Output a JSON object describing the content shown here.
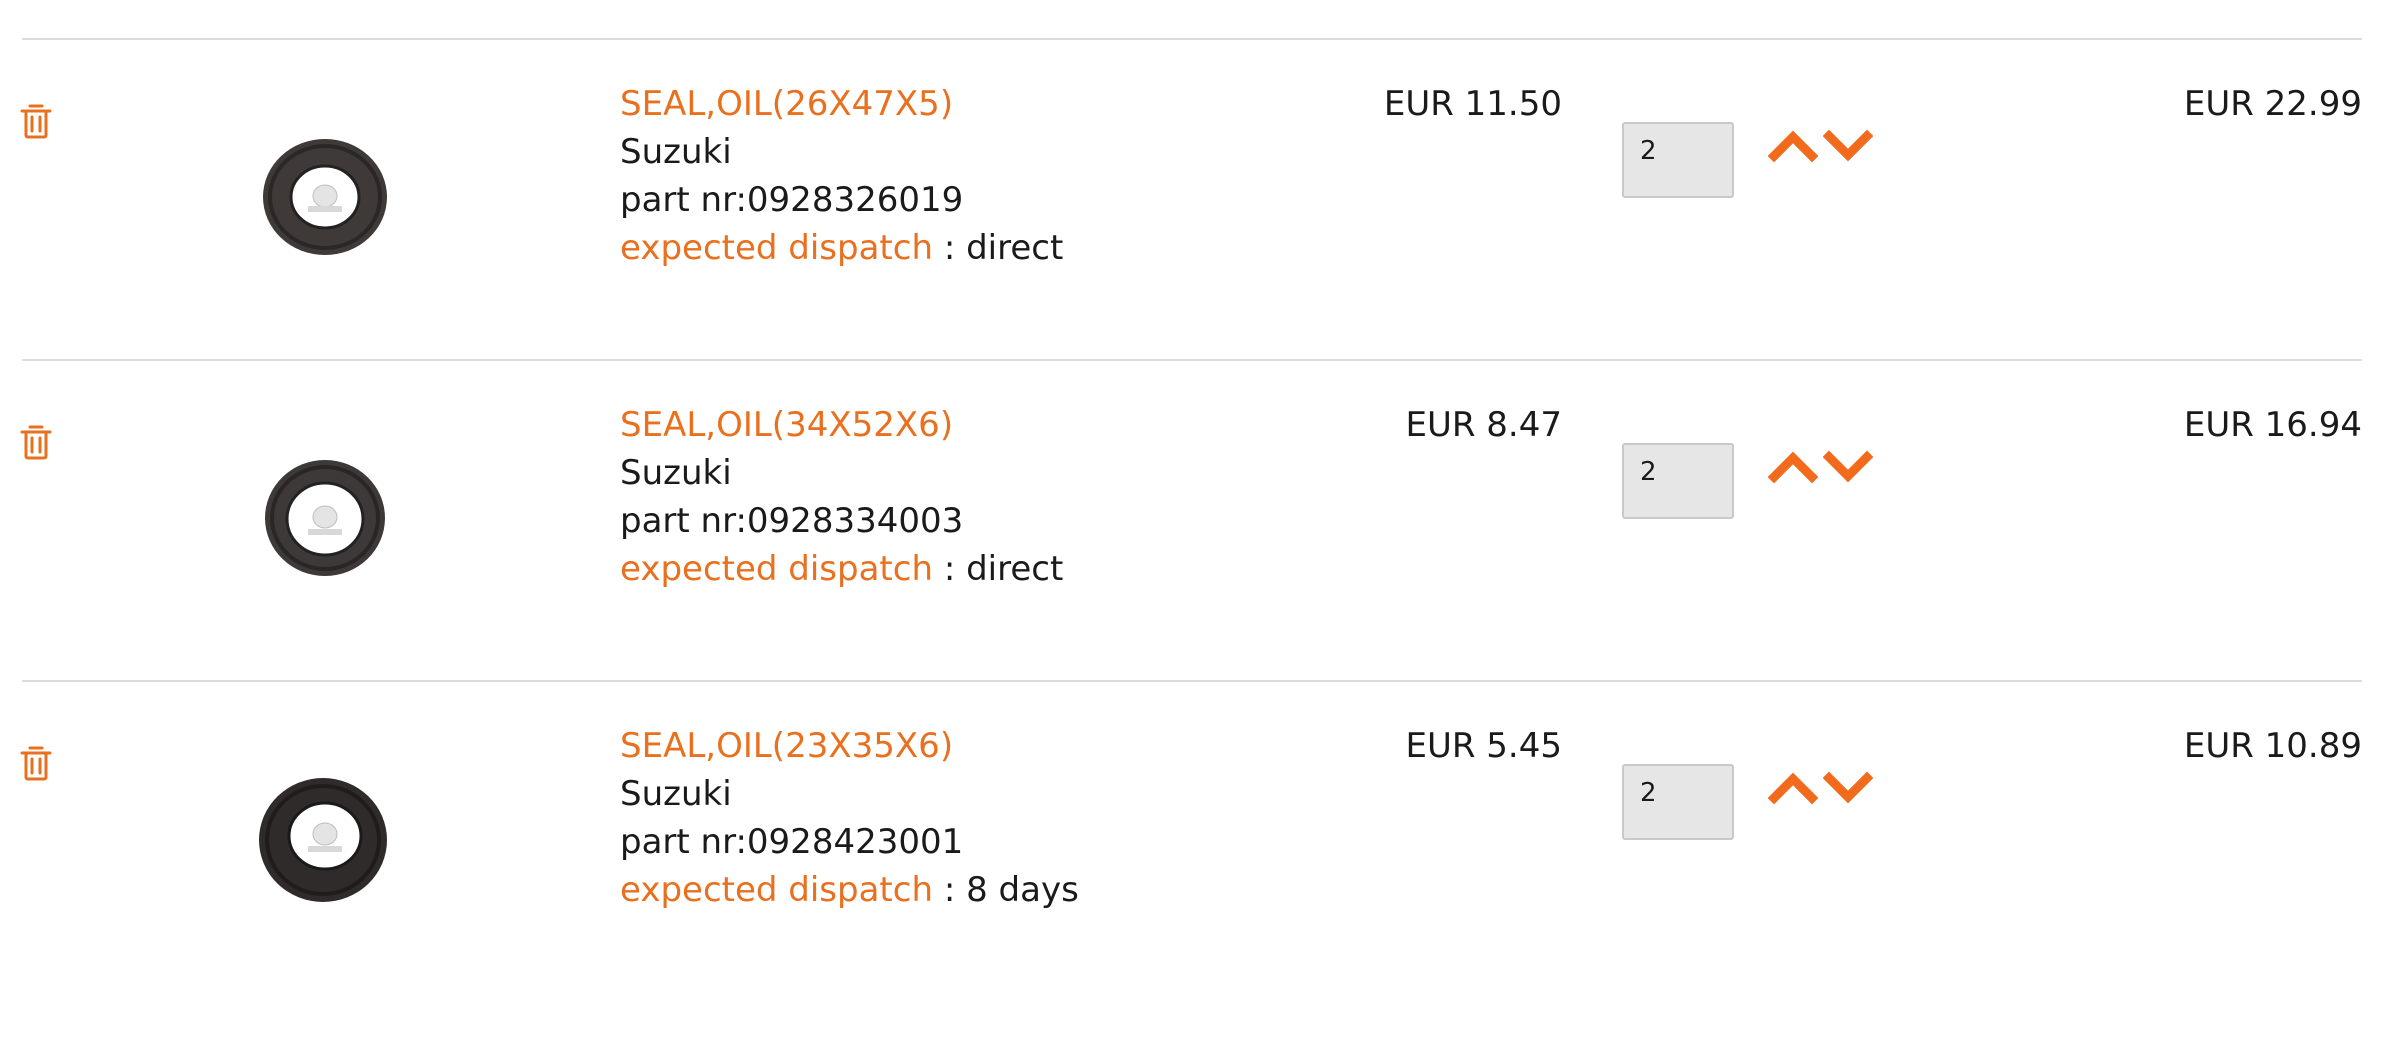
{
  "accent_color": "#e8701e",
  "items": [
    {
      "name": "SEAL,OIL(26X47X5)",
      "brand": "Suzuki",
      "part_nr": "part nr:0928326019",
      "dispatch_label": "expected dispatch",
      "dispatch_value": " : direct",
      "unit_price": "EUR 11.50",
      "quantity": "2",
      "line_total": "EUR 22.99",
      "icons": {
        "delete": "trash-icon",
        "increase": "chevron-up-icon",
        "decrease": "chevron-down-icon"
      }
    },
    {
      "name": "SEAL,OIL(34X52X6)",
      "brand": "Suzuki",
      "part_nr": "part nr:0928334003",
      "dispatch_label": "expected dispatch",
      "dispatch_value": " : direct",
      "unit_price": "EUR 8.47",
      "quantity": "2",
      "line_total": "EUR 16.94",
      "icons": {
        "delete": "trash-icon",
        "increase": "chevron-up-icon",
        "decrease": "chevron-down-icon"
      }
    },
    {
      "name": "SEAL,OIL(23X35X6)",
      "brand": "Suzuki",
      "part_nr": "part nr:0928423001",
      "dispatch_label": "expected dispatch",
      "dispatch_value": " : 8 days",
      "unit_price": "EUR 5.45",
      "quantity": "2",
      "line_total": "EUR 10.89",
      "icons": {
        "delete": "trash-icon",
        "increase": "chevron-up-icon",
        "decrease": "chevron-down-icon"
      }
    }
  ]
}
